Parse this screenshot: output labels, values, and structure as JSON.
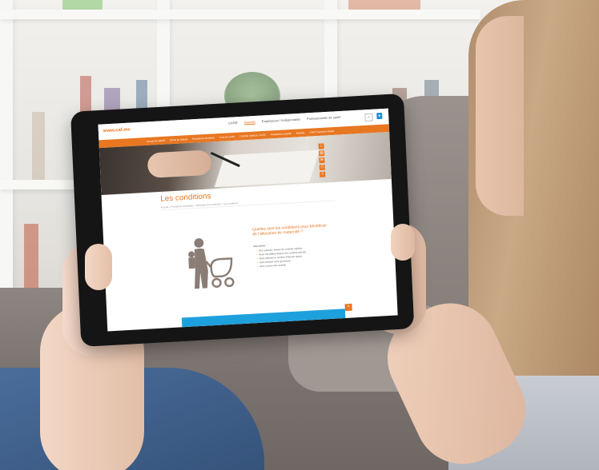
{
  "site": {
    "logo": "www.caf.mc",
    "top_nav": [
      "CAFIE",
      "Salariés",
      "Employeurs / Indépendants",
      "Professionnels de santé"
    ],
    "orange_nav": [
      "Accueil du salarié",
      "Droits du Salarié",
      "Prestations familiales",
      "Frais de santé",
      "Contrôle médical / CCSS",
      "Prestations maladie",
      "Retraite",
      "CAMTI Services Mobile"
    ]
  },
  "page": {
    "title": "Les conditions",
    "breadcrumb": "Accueil > Prestations familiales > Allocation de maternité > Les conditions",
    "question_title": "Quelles sont les conditions pour bénéficier de l'allocation de maternité ?",
    "intro": "Vous devez :",
    "bullets": [
      "Être salariée, relever du contrôle médical",
      "Avoir été affiliée depuis une certaine période",
      "Avoir effectué le nombre d'heures requis",
      "Avoir déclaré votre grossesse",
      "Avoir cessé votre activité"
    ]
  },
  "icons": {
    "search": "search-icon",
    "user": "user-icon",
    "scroll_top": "chevron-up-icon",
    "side": [
      "home-icon",
      "document-icon",
      "mail-icon",
      "print-icon",
      "share-icon"
    ]
  },
  "colors": {
    "accent": "#e87722",
    "blue": "#1ea0dd"
  }
}
